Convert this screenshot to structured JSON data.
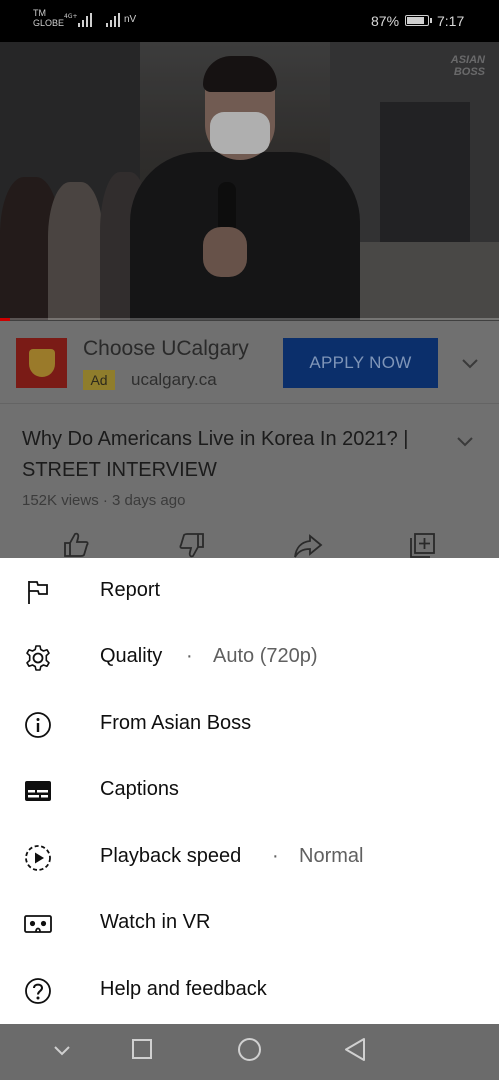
{
  "status_bar": {
    "carrier_line1": "TM",
    "carrier_line2": "GLOBE",
    "network_type": "4G+",
    "network_label": "nV",
    "battery_percent": "87%",
    "battery_level": 0.87,
    "time": "7:17"
  },
  "video": {
    "watermark_line1": "ASIAN",
    "watermark_line2": "BOSS",
    "progress": 0.02
  },
  "ad": {
    "title": "Choose UCalgary",
    "badge": "Ad",
    "domain": "ucalgary.ca",
    "cta": "APPLY NOW"
  },
  "video_info": {
    "title": "Why Do Americans Live in Korea In 2021? | STREET INTERVIEW",
    "meta": "152K views · 3 days ago"
  },
  "menu": {
    "items": [
      {
        "label": "Report",
        "icon": "flag-icon"
      },
      {
        "label": "Quality",
        "separator": "·",
        "value": "Auto (720p)",
        "icon": "gear-icon"
      },
      {
        "label": "From Asian Boss",
        "icon": "info-icon"
      },
      {
        "label": "Captions",
        "icon": "captions-icon"
      },
      {
        "label": "Playback speed",
        "separator": "·",
        "value": "Normal",
        "icon": "playback-speed-icon"
      },
      {
        "label": "Watch in VR",
        "icon": "vr-icon"
      },
      {
        "label": "Help and feedback",
        "icon": "help-icon"
      }
    ]
  },
  "colors": {
    "accent_red": "#cc0000",
    "cta_blue": "#0b2f6b",
    "sheet_bg": "#ffffff",
    "dim_overlay": "#707070"
  }
}
